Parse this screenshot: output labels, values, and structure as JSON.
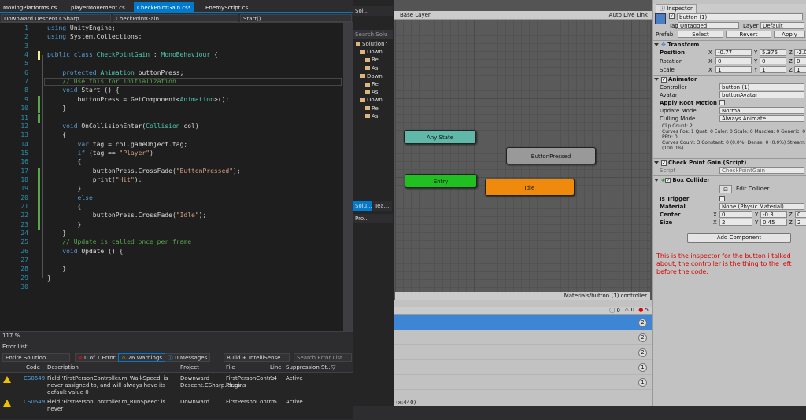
{
  "vs": {
    "tabs": [
      "MovingPlatforms.cs",
      "playerMovement.cs",
      "CheckPointGain.cs*",
      "EnemyScript.cs"
    ],
    "nav": {
      "project": "Downward Descent.CSharp",
      "class": "CheckPointGain",
      "method": "Start()"
    },
    "code_lines": [
      {
        "n": "1",
        "html": "<span class='kw'>using</span> UnityEngine;"
      },
      {
        "n": "2",
        "html": "<span class='kw'>using</span> System.Collections;"
      },
      {
        "n": "3",
        "html": ""
      },
      {
        "n": "4",
        "html": "<span class='kw'>public class</span> <span class='ty'>CheckPointGain</span> : <span class='ty'>MonoBehaviour</span> {"
      },
      {
        "n": "5",
        "html": ""
      },
      {
        "n": "6",
        "html": "    <span class='kw'>protected</span> <span class='ty'>Animation</span> buttonPress;"
      },
      {
        "n": "7",
        "html": "    <span class='cm'>// Use this for initialization</span>"
      },
      {
        "n": "8",
        "html": "    <span class='kw'>void</span> Start () {"
      },
      {
        "n": "9",
        "html": "        buttonPress = GetComponent&lt;<span class='ty'>Animation</span>&gt;();"
      },
      {
        "n": "10",
        "html": "    }"
      },
      {
        "n": "11",
        "html": ""
      },
      {
        "n": "12",
        "html": "    <span class='kw'>void</span> OnCollisionEnter(<span class='ty'>Collision</span> col)"
      },
      {
        "n": "13",
        "html": "    {"
      },
      {
        "n": "14",
        "html": "        <span class='kw'>var</span> tag = col.gameObject.tag;"
      },
      {
        "n": "15",
        "html": "        <span class='kw'>if</span> (tag == <span class='st'>\"Player\"</span>)"
      },
      {
        "n": "16",
        "html": "        {"
      },
      {
        "n": "17",
        "html": "            buttonPress.CrossFade(<span class='st'>\"ButtonPressed\"</span>);"
      },
      {
        "n": "18",
        "html": "            print(<span class='st'>\"Hit\"</span>);"
      },
      {
        "n": "19",
        "html": "        }"
      },
      {
        "n": "20",
        "html": "        <span class='kw'>else</span>"
      },
      {
        "n": "21",
        "html": "        {"
      },
      {
        "n": "22",
        "html": "            buttonPress.CrossFade(<span class='st'>\"Idle\"</span>);"
      },
      {
        "n": "23",
        "html": "        }"
      },
      {
        "n": "24",
        "html": "    }"
      },
      {
        "n": "25",
        "html": "    <span class='cm'>// Update is called once per frame</span>"
      },
      {
        "n": "26",
        "html": "    <span class='kw'>void</span> Update () {"
      },
      {
        "n": "27",
        "html": ""
      },
      {
        "n": "28",
        "html": "    }"
      },
      {
        "n": "29",
        "html": "}"
      },
      {
        "n": "30",
        "html": ""
      }
    ],
    "zoom": "117 %",
    "error_list": {
      "title": "Error List",
      "scope": "Entire Solution",
      "errors": "0 of 1 Error",
      "warnings": "26 Warnings",
      "messages": "0 Messages",
      "build": "Build + IntelliSense",
      "search_placeholder": "Search Error List",
      "columns": [
        "Code",
        "Description",
        "Project",
        "File",
        "Line",
        "Suppression St..."
      ],
      "rows": [
        {
          "code": "CS0649",
          "desc": "Field 'FirstPersonController.m_WalkSpeed' is never assigned to, and will always have its default value 0",
          "project": "Downward Descent.CSharp.Plugins",
          "file": "FirstPersonControl ler.cs",
          "line": "14",
          "supp": "Active"
        },
        {
          "code": "CS0649",
          "desc": "Field 'FirstPersonController.m_RunSpeed' is never",
          "project": "Downward",
          "file": "FirstPersonControl",
          "line": "15",
          "supp": "Active"
        }
      ]
    }
  },
  "solution": {
    "tab": "Sol...",
    "search": "Search Solu",
    "items": [
      "Solution '",
      "Down",
      "Re",
      "As",
      "Down",
      "Re",
      "As",
      "Down",
      "Re",
      "As"
    ],
    "bottom_tabs": [
      "Solu...",
      "Tea..."
    ],
    "prop_tab": "Pro..."
  },
  "animator": {
    "layer": "Base Layer",
    "auto_live": "Auto Live Link",
    "nodes": {
      "any": "Any State",
      "pressed": "ButtonPressed",
      "entry": "Entry",
      "idle": "Idle"
    },
    "footer": "Materials/button (1).controller"
  },
  "console": {
    "counts": [
      "0",
      "0",
      "5"
    ],
    "badges": [
      "2",
      "2",
      "2",
      "1",
      "1"
    ],
    "bottom_text": "(x:440)"
  },
  "inspector": {
    "tab": "Inspector",
    "object_name": "button (1)",
    "tag_label": "Tag",
    "tag": "Untagged",
    "layer_label": "Layer",
    "layer": "Default",
    "prefab_label": "Prefab",
    "prefab_buttons": [
      "Select",
      "Revert",
      "Apply"
    ],
    "transform": {
      "title": "Transform",
      "position": "Position",
      "rotation": "Rotation",
      "scale": "Scale",
      "px": "-0.77",
      "py": "5.375",
      "pz": "-2.0",
      "rx": "0",
      "ry": "0",
      "rz": "0",
      "sx": "1",
      "sy": "1",
      "sz": "1"
    },
    "animator": {
      "title": "Animator",
      "controller_label": "Controller",
      "controller": "button (1)",
      "avatar_label": "Avatar",
      "avatar": "buttonAvatar",
      "root_motion": "Apply Root Motion",
      "update_label": "Update Mode",
      "update": "Normal",
      "culling_label": "Culling Mode",
      "culling": "Always Animate",
      "info": [
        "Clip Count: 2",
        "Curves Pos: 1 Quat: 0 Euler: 0 Scale: 0 Muscles: 0 Generic: 0",
        "PPtr: 0",
        "Curves Count: 3 Constant: 0 (0.0%) Dense: 0 (0.0%) Stream: 3",
        "(100.0%)"
      ]
    },
    "script": {
      "title": "Check Point Gain (Script)",
      "label": "Script",
      "value": "CheckPointGain"
    },
    "collider": {
      "title": "Box Collider",
      "edit": "Edit Collider",
      "trigger": "Is Trigger",
      "material_label": "Material",
      "material": "None (Physic Material)",
      "center": "Center",
      "size": "Size",
      "cx": "0",
      "cy": "-0.3",
      "cz": "0",
      "szx": "2",
      "szy": "0.45",
      "szz": "2"
    },
    "add_component": "Add Component",
    "note": "This is the inspector for the button i talked about, the controller is the thing to the left before the code."
  },
  "axis_labels": {
    "x": "X",
    "y": "Y",
    "z": "Z"
  },
  "colors": {
    "vs_accent": "#007acc",
    "any_state": "#5fb8a8",
    "entry": "#1fc01f",
    "idle": "#f08a0c",
    "button_pressed": "#999999",
    "console_select": "#3d86d6",
    "note": "#d60000"
  }
}
